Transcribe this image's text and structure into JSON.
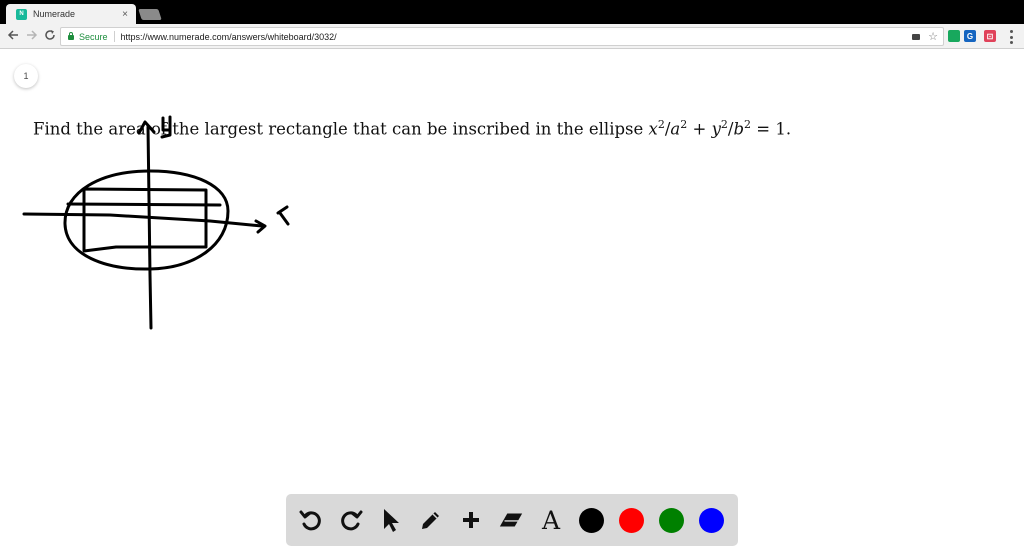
{
  "browser": {
    "tab_title": "Numerade",
    "favicon_text": "N",
    "close_glyph": "×",
    "secure_label": "Secure",
    "url": "https://www.numerade.com/answers/whiteboard/3032/",
    "icons": {
      "back": "arrow-left-icon",
      "forward": "arrow-right-icon",
      "reload": "reload-icon",
      "lock": "lock-icon",
      "camera": "video-camera-icon",
      "star": "star-icon",
      "ext_green": "extension-icon",
      "ext_grammarly": "grammarly-icon",
      "ext_pocket": "pocket-icon",
      "menu": "more-vert-icon"
    }
  },
  "whiteboard": {
    "page_number": "1",
    "question_prefix": "Find the area of the largest rectangle that can be inscribed in the ellipse ",
    "eq": {
      "x": "x",
      "a": "a",
      "y": "y",
      "b": "b",
      "exp": "2",
      "slash": "/",
      "plus": " + ",
      "equals": " = ",
      "rhs": "1",
      "end": "."
    },
    "ink_color": "#000000"
  },
  "tools": {
    "undo": "undo-icon",
    "redo": "redo-icon",
    "select": "pointer-icon",
    "pen": "pencil-icon",
    "add": "plus-icon",
    "eraser": "eraser-icon",
    "text_label": "A",
    "colors": [
      "#000000",
      "#ff0000",
      "#008000",
      "#0000ff"
    ],
    "color_names": [
      "black",
      "red",
      "green",
      "blue"
    ]
  }
}
